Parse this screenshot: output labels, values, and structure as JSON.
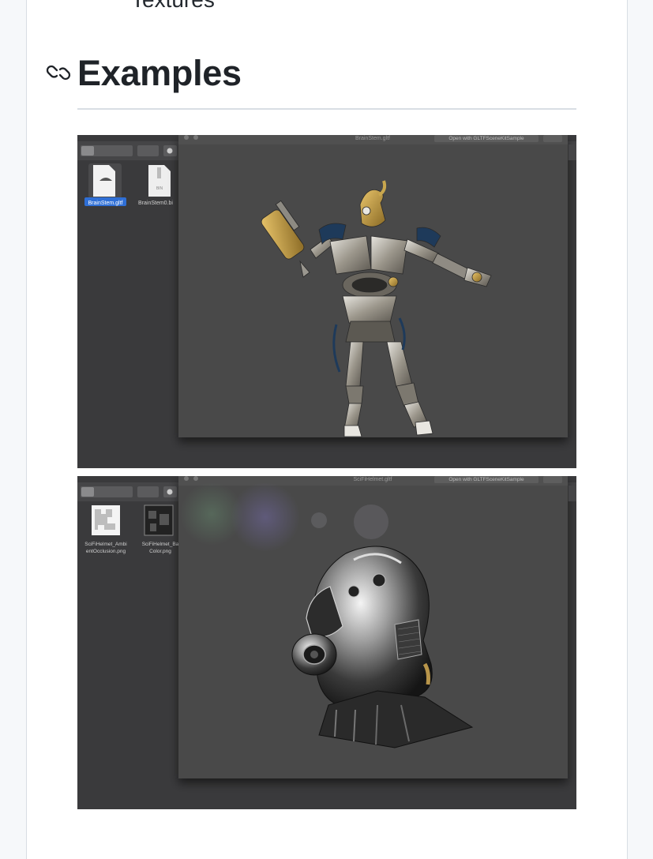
{
  "previous_section": {
    "text": "Textures"
  },
  "section": {
    "title": "Examples",
    "anchor_icon": "link-icon"
  },
  "screenshots": [
    {
      "window_title": "BrainStem.gltf",
      "open_with_label": "Open with GLTFSceneKitSample",
      "files": [
        {
          "name": "BrainStem.gltf",
          "icon": "gltf-document-icon",
          "selected": true
        },
        {
          "name": "BrainStem0.bi",
          "icon": "bin-document-icon",
          "selected": false
        }
      ],
      "model": "robot-model",
      "colors": {
        "viewport": "#4a4a4a",
        "finder": "#3a3a3c",
        "selection": "#2f6fd6"
      }
    },
    {
      "window_title": "SciFiHelmet.gltf",
      "open_with_label": "Open with GLTFSceneKitSample",
      "files": [
        {
          "name": "SciFiHelmet_Ambi",
          "name_line2": "entOcclusion.png",
          "icon": "png-image-icon"
        },
        {
          "name": "SciFiHelmet_Ba",
          "name_line2": "Color.png",
          "icon": "png-image-icon"
        }
      ],
      "model": "helmet-model",
      "colors": {
        "viewport": "#4a4a4a",
        "finder": "#3a3a3c"
      }
    }
  ]
}
